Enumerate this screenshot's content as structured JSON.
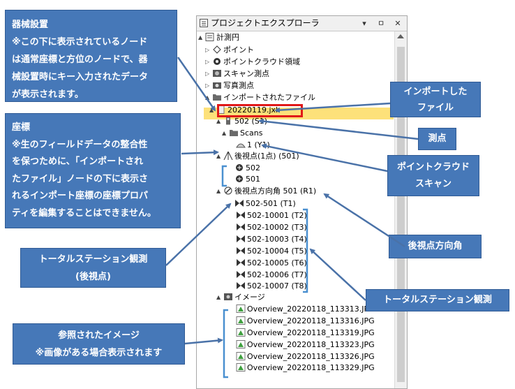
{
  "explorer": {
    "title": "プロジェクトエクスプローラ",
    "pin_glyph": "⇩",
    "pin_glyph2": "ꟼ",
    "close_glyph": "✕"
  },
  "tree": [
    {
      "label": "計測円",
      "icon": "project-icon"
    },
    {
      "label": "ポイント",
      "icon": "point-icon"
    },
    {
      "label": "ポイントクラウド領域",
      "icon": "pointcloud-region-icon"
    },
    {
      "label": "スキャン測点",
      "icon": "scan-station-icon"
    },
    {
      "label": "写真測点",
      "icon": "photo-station-icon"
    },
    {
      "label": "インポートされたファイル",
      "icon": "folder-icon"
    },
    {
      "label": "20220119.jxl",
      "icon": "file-icon"
    },
    {
      "label": "502 (S1)",
      "icon": "station-icon"
    },
    {
      "label": "Scans",
      "icon": "folder-icon"
    },
    {
      "label": "1 (Y1)",
      "icon": "scan-icon"
    },
    {
      "label": "後視点(1点) (501)",
      "icon": "backsight-icon"
    },
    {
      "label": "502",
      "icon": "target-icon"
    },
    {
      "label": "501",
      "icon": "target-icon"
    },
    {
      "label": "後視点方向角 501 (R1)",
      "icon": "orientation-icon"
    },
    {
      "label": "502-501 (T1)",
      "icon": "ts-obs-icon"
    },
    {
      "label": "502-10001 (T2)",
      "icon": "ts-obs-icon"
    },
    {
      "label": "502-10002 (T3)",
      "icon": "ts-obs-icon"
    },
    {
      "label": "502-10003 (T4)",
      "icon": "ts-obs-icon"
    },
    {
      "label": "502-10004 (T5)",
      "icon": "ts-obs-icon"
    },
    {
      "label": "502-10005 (T6)",
      "icon": "ts-obs-icon"
    },
    {
      "label": "502-10006 (T7)",
      "icon": "ts-obs-icon"
    },
    {
      "label": "502-10007 (T8)",
      "icon": "ts-obs-icon"
    },
    {
      "label": "イメージ",
      "icon": "image-folder-icon"
    },
    {
      "label": "Overview_20220118_113313.JPG",
      "icon": "image-icon"
    },
    {
      "label": "Overview_20220118_113316.JPG",
      "icon": "image-icon"
    },
    {
      "label": "Overview_20220118_113319.JPG",
      "icon": "image-icon"
    },
    {
      "label": "Overview_20220118_113323.JPG",
      "icon": "image-icon"
    },
    {
      "label": "Overview_20220118_113326.JPG",
      "icon": "image-icon"
    },
    {
      "label": "Overview_20220118_113329.JPG",
      "icon": "image-icon"
    }
  ],
  "callouts": {
    "kikai": [
      "器械設置",
      "※この下に表示されているノード",
      "は通常座標と方位のノードで、器",
      "械設置時にキー入力されたデータ",
      "が表示されます。"
    ],
    "zahyo": [
      "座標",
      "※生のフィールドデータの整合性",
      "を保つために、「インポートされ",
      "たファイル」ノードの下に表示さ",
      "れるインポート座標の座標プロパ",
      "ティを編集することはできません。"
    ],
    "import": [
      "インポートした",
      "ファイル"
    ],
    "sokuten": [
      "測点"
    ],
    "pointcloud": [
      "ポイントクラウド",
      "スキャン"
    ],
    "koushi": [
      "後視点方向角"
    ],
    "ts_backsight": [
      "トータルステーション観測",
      "(後視点)"
    ],
    "ts": [
      "トータルステーション観測"
    ],
    "image": [
      "参照されたイメージ",
      "※画像がある場合表示されます"
    ]
  },
  "colors": {
    "callout_bg": "#4678b8",
    "arrow": "#4a72a8",
    "selection": "#fde17a",
    "highlight_border": "#e01818",
    "bracket": "#4a90d0"
  }
}
